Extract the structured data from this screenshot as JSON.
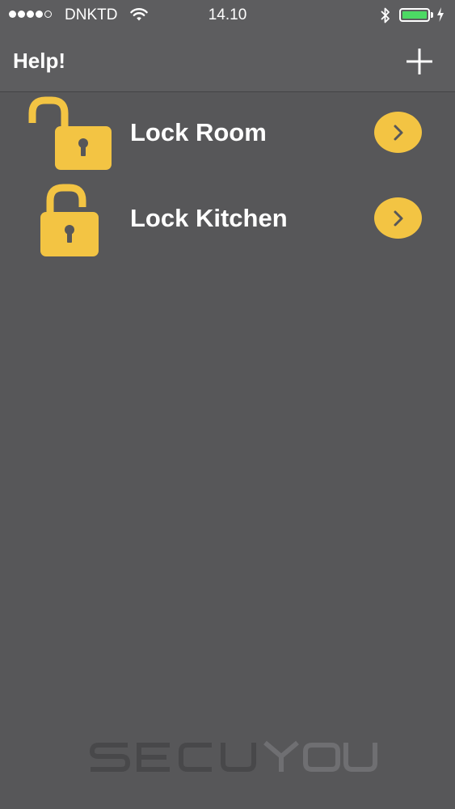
{
  "status_bar": {
    "carrier": "DNKTD",
    "time": "14.10",
    "signal_bars": 4,
    "signal_max": 5,
    "battery_level": 1.0,
    "icons": [
      "wifi-icon",
      "bluetooth-icon",
      "battery-icon",
      "charging-bolt-icon"
    ]
  },
  "nav": {
    "help_label": "Help!",
    "add_icon": "plus-icon"
  },
  "locks": [
    {
      "name": "Lock Room",
      "state": "unlocked"
    },
    {
      "name": "Lock Kitchen",
      "state": "unlocked"
    }
  ],
  "brand": {
    "logo_text": "SECUYOU"
  },
  "colors": {
    "background": "#575759",
    "bar": "#5d5d5f",
    "accent": "#f3c443",
    "lock_body": "#f3c443",
    "text": "#ffffff",
    "battery": "#4cd964"
  }
}
